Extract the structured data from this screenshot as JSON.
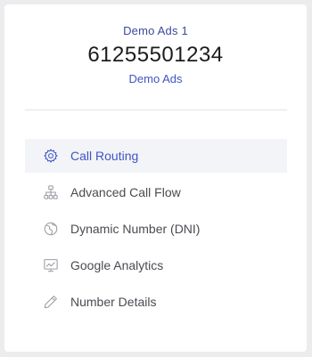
{
  "header": {
    "account_name": "Demo Ads 1",
    "phone_number": "61255501234",
    "campaign_link": "Demo Ads"
  },
  "menu": {
    "items": [
      {
        "label": "Call Routing",
        "icon": "gear-icon",
        "active": true
      },
      {
        "label": "Advanced Call Flow",
        "icon": "sitemap-icon",
        "active": false
      },
      {
        "label": "Dynamic Number (DNI)",
        "icon": "globe-icon",
        "active": false
      },
      {
        "label": "Google Analytics",
        "icon": "analytics-chart-icon",
        "active": false
      },
      {
        "label": "Number Details",
        "icon": "pencil-icon",
        "active": false
      }
    ]
  },
  "colors": {
    "accent": "#3f55c6",
    "active_bg": "#f3f4f7",
    "text": "#4a4a52",
    "icon_gray": "#9a9aa3"
  }
}
